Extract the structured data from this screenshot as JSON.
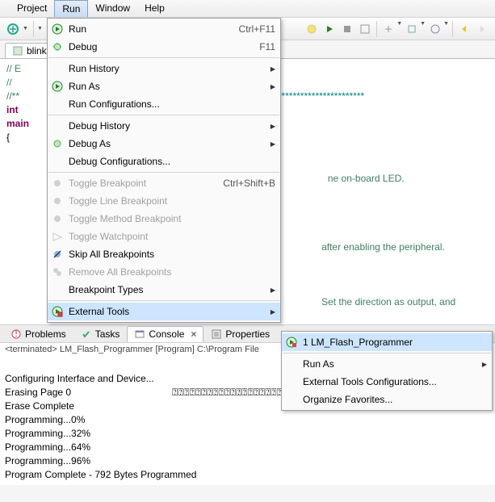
{
  "menubar": {
    "items": [
      "Project",
      "Run",
      "Window",
      "Help"
    ],
    "active_index": 1
  },
  "editor_tab": "blinky",
  "run_menu": {
    "run": "Run",
    "run_acc": "Ctrl+F11",
    "debug": "Debug",
    "debug_acc": "F11",
    "run_history": "Run History",
    "run_as": "Run As",
    "run_config": "Run Configurations...",
    "debug_history": "Debug History",
    "debug_as": "Debug As",
    "debug_config": "Debug Configurations...",
    "tog_bp": "Toggle Breakpoint",
    "tog_bp_acc": "Ctrl+Shift+B",
    "tog_line": "Toggle Line Breakpoint",
    "tog_meth": "Toggle Method Breakpoint",
    "tog_watch": "Toggle Watchpoint",
    "skip_all": "Skip All Breakpoints",
    "remove_all": "Remove All Breakpoints",
    "bp_types": "Breakpoint Types",
    "ext_tools": "External Tools"
  },
  "ext_menu": {
    "item1": "1 LM_Flash_Programmer",
    "run_as": "Run As",
    "config": "External Tools Configurations...",
    "org_fav": "Organize Favorites..."
  },
  "code": {
    "l1": "// E",
    "l2": "//",
    "l3": "//**",
    "l4a": "int",
    "l4b": "",
    "l5": "main",
    "l6": "{",
    "star_row": "*********************************",
    "c1": "ne on-board LED.",
    "c2": "after enabling the peripheral.",
    "c3": "Set the direction as output, and"
  },
  "bottom_tabs": {
    "problems": "Problems",
    "tasks": "Tasks",
    "console": "Console",
    "properties": "Properties"
  },
  "term_line": "<terminated> LM_Flash_Programmer [Program] C:\\Program File",
  "console": {
    "l1": "Configuring Interface and Device...",
    "l2": "Erasing Page 0",
    "l2b": "⍰⍰⍰⍰⍰⍰⍰⍰⍰⍰⍰⍰⍰⍰⍰⍰⍰⍰⍰⍰⍰⍰⍰⍰⍰⍰",
    "l3": "Erase Complete",
    "l4": "Programming...0%",
    "l5": "Programming...32%",
    "l6": "Programming...64%",
    "l7": "Programming...96%",
    "l8": "Program Complete - 792 Bytes Programmed"
  }
}
